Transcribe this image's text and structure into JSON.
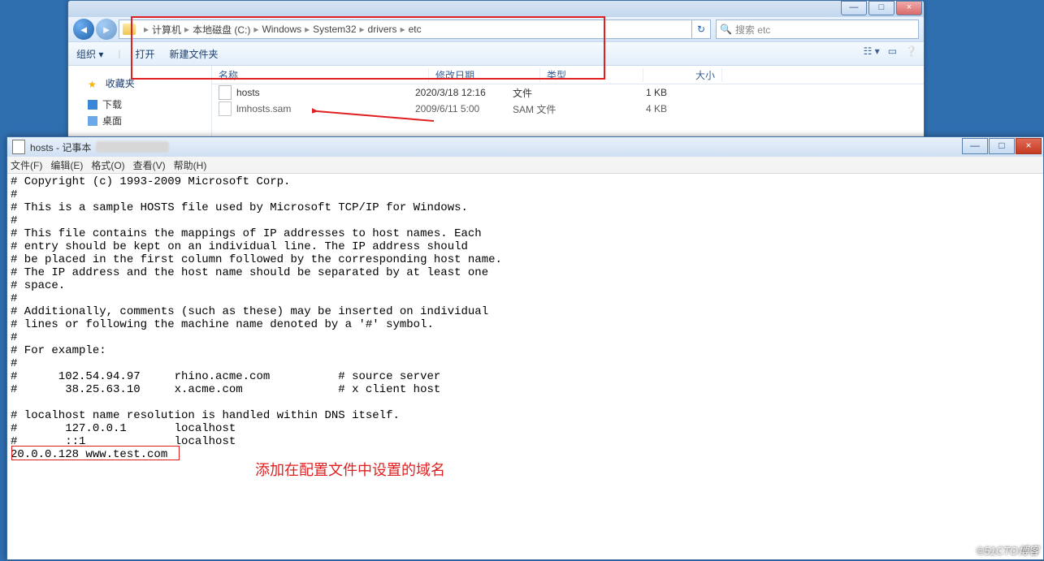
{
  "explorer": {
    "win_min": "—",
    "win_max": "□",
    "win_close": "×",
    "breadcrumb": [
      "计算机",
      "本地磁盘 (C:)",
      "Windows",
      "System32",
      "drivers",
      "etc"
    ],
    "search_placeholder": "搜索 etc",
    "toolbar": {
      "organize": "组织 ▾",
      "open": "打开",
      "newfolder": "新建文件夹"
    },
    "columns": {
      "name": "名称",
      "date": "修改日期",
      "type": "类型",
      "size": "大小"
    },
    "nav": {
      "fav": "收藏夹",
      "downloads": "下载",
      "desktop": "桌面"
    },
    "files": [
      {
        "name": "hosts",
        "date": "2020/3/18 12:16",
        "type": "文件",
        "size": "1 KB"
      },
      {
        "name": "lmhosts.sam",
        "date": "2009/6/11 5:00",
        "type": "SAM 文件",
        "size": "4 KB"
      }
    ]
  },
  "notepad": {
    "title": "hosts - 记事本",
    "menu": {
      "file": "文件(F)",
      "edit": "编辑(E)",
      "format": "格式(O)",
      "view": "查看(V)",
      "help": "帮助(H)"
    },
    "content": "# Copyright (c) 1993-2009 Microsoft Corp.\n#\n# This is a sample HOSTS file used by Microsoft TCP/IP for Windows.\n#\n# This file contains the mappings of IP addresses to host names. Each\n# entry should be kept on an individual line. The IP address should\n# be placed in the first column followed by the corresponding host name.\n# The IP address and the host name should be separated by at least one\n# space.\n#\n# Additionally, comments (such as these) may be inserted on individual\n# lines or following the machine name denoted by a '#' symbol.\n#\n# For example:\n#\n#      102.54.94.97     rhino.acme.com          # source server\n#       38.25.63.10     x.acme.com              # x client host\n\n# localhost name resolution is handled within DNS itself.\n#\t127.0.0.1       localhost\n#\t::1             localhost\n20.0.0.128 www.test.com",
    "annotation": "添加在配置文件中设置的域名"
  },
  "watermark": "©51CTO博客"
}
